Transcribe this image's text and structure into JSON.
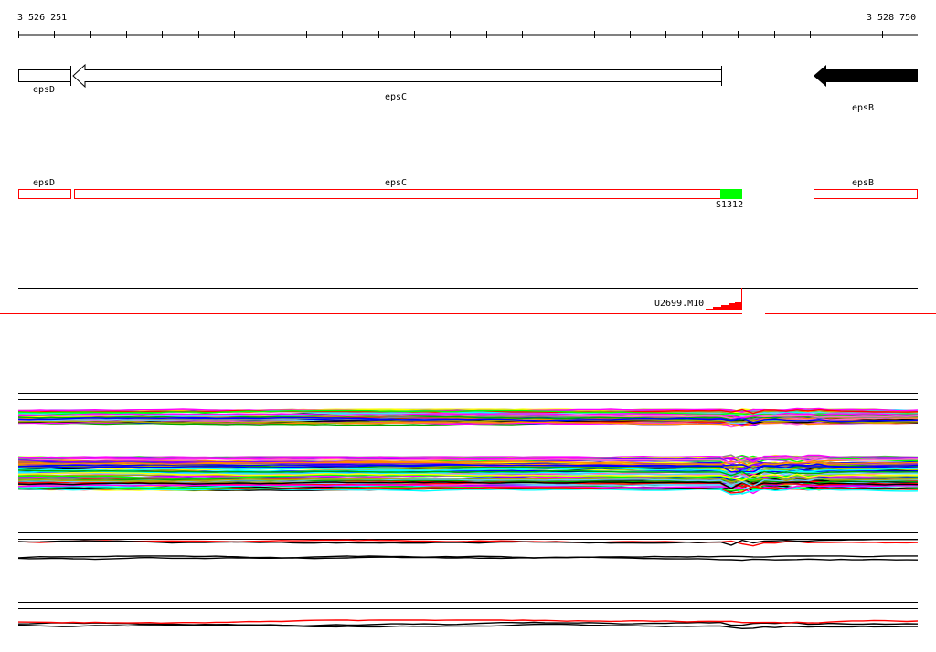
{
  "ruler": {
    "start_label": "3 526 251",
    "end_label": "3 528 750"
  },
  "genes": [
    {
      "name": "epsD",
      "strand": "-",
      "style": "outline"
    },
    {
      "name": "epsC",
      "strand": "-",
      "style": "outline"
    },
    {
      "name": "epsB",
      "strand": "-",
      "style": "filled"
    }
  ],
  "features": {
    "labels": [
      "epsD",
      "epsC",
      "epsB"
    ],
    "site_label": "S1312",
    "site_color": "#00ff00",
    "outline_color": "#ff0000"
  },
  "peak_track": {
    "label": "U2699.M10",
    "color": "#ff0000"
  },
  "expression_colors": [
    "#ff0000",
    "#00ff00",
    "#0000ff",
    "#ff00ff",
    "#00ffff",
    "#ffff00",
    "#ff8800",
    "#8800ff",
    "#000000",
    "#888888",
    "#00aa00",
    "#ff66cc",
    "#66ccff",
    "#aaaa00"
  ]
}
